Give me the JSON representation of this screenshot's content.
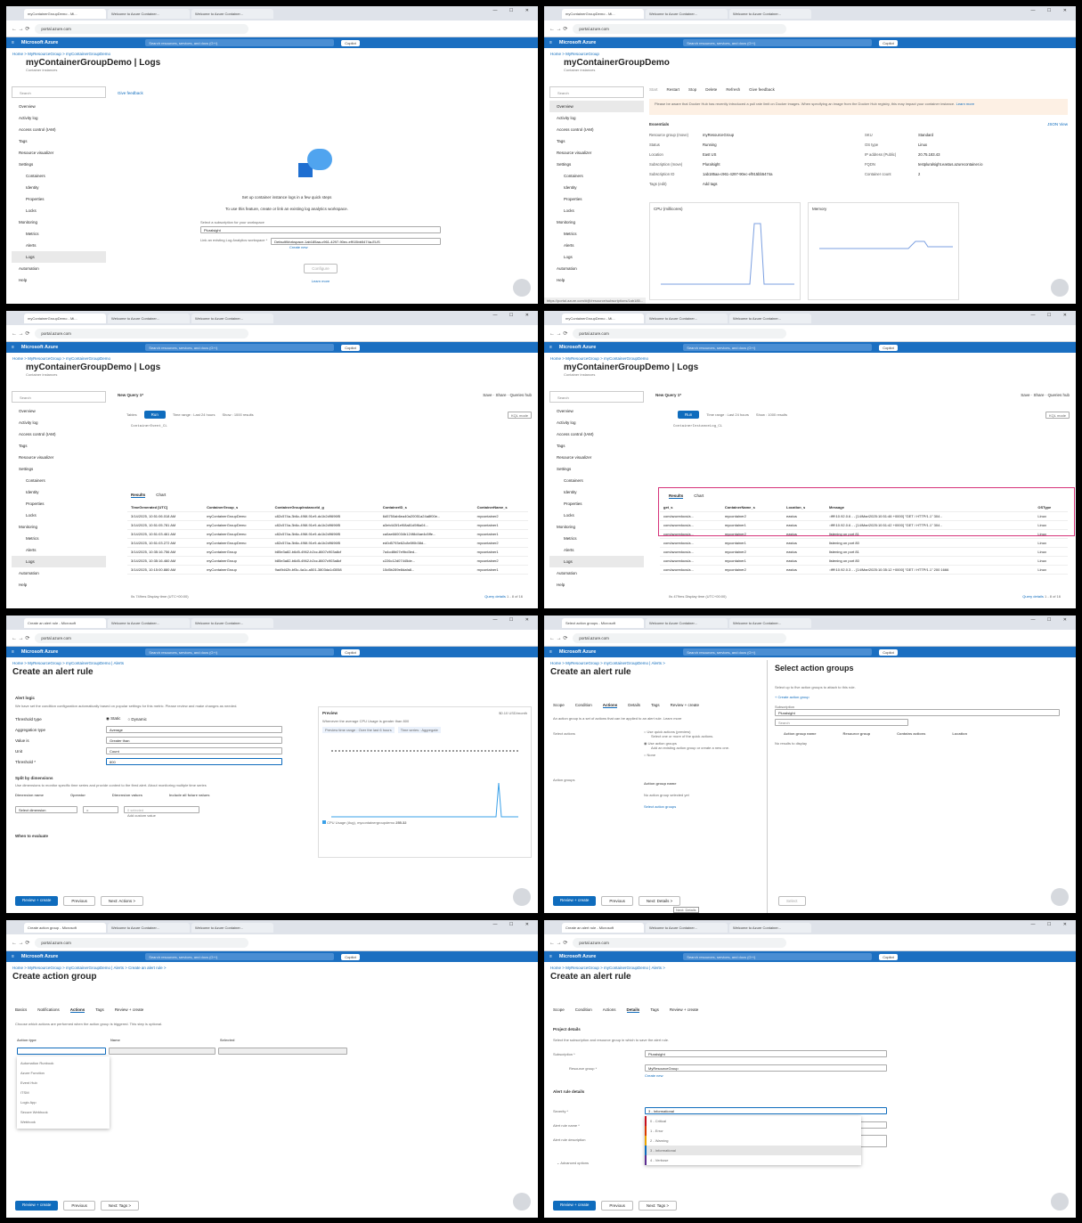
{
  "tabs": {
    "p1": [
      "myContainerGroupDemo - Mi...",
      "Welcome to Azure Container...",
      "Welcome to Azure Container..."
    ],
    "p5": [
      "Create an alert rule - Microsoft",
      "Welcome to Azure Container...",
      "Welcome to Azure Container..."
    ],
    "p6": [
      "Select action groups - Microsoft",
      "Welcome to Azure Container...",
      "Welcome to Azure Container..."
    ],
    "p7": [
      "Create action group - Microsoft",
      "Welcome to Azure Container...",
      "Welcome to Azure Container..."
    ],
    "p8": [
      "Create an alert rule - Microsoft",
      "Welcome to Azure Container...",
      "Welcome to Azure Container..."
    ]
  },
  "common": {
    "url": "portal.azure.com",
    "brand": "Microsoft Azure",
    "search": "Search resources, services, and docs (G+/)",
    "copilot": "Copilot",
    "window": "— ☐ ✕"
  },
  "side": {
    "search": "Search",
    "items": [
      "Overview",
      "Activity log",
      "Access control (IAM)",
      "Tags",
      "Resource visualizer",
      "Settings",
      "Containers",
      "Identity",
      "Properties",
      "Locks",
      "Monitoring",
      "Metrics",
      "Alerts",
      "Logs",
      "Automation",
      "Help"
    ]
  },
  "p1": {
    "bc": "Home > MyResourceGroup > myContainerGroupDemo",
    "title": "myContainerGroupDemo | Logs",
    "sub": "Container instances",
    "feedback": "Give feedback",
    "setup1": "Set up container instance logs in a few quick steps",
    "setup2": "To use this feature, create or link an existing log analytics workspace.",
    "sublabel": "Select a subscription for your workspace",
    "subval": "Pluralsight",
    "wslabel": "Link an existing Log Analytics workspace *",
    "wsval": "DefaultWorkspace-1ab185aa-c961-4297-90ec-ef915bb5474a-EUS",
    "create": "Create new",
    "configure": "Configure",
    "learn": "Learn more"
  },
  "p2": {
    "bc": "Home > MyResourceGroup",
    "title": "myContainerGroupDemo",
    "sub": "Container instances",
    "toolbar": [
      "Start",
      "Restart",
      "Stop",
      "Delete",
      "Refresh",
      "Give feedback"
    ],
    "warn": "Please be aware that Docker Hub has recently introduced a pull rate limit on Docker images. When specifying an image from the Docker Hub registry, this may impact your container instance.",
    "learn": "Learn more",
    "essentials": "Essentials",
    "json": "JSON View",
    "left": [
      [
        "Resource group (move)",
        "myResourceGroup"
      ],
      [
        "Status",
        "Running"
      ],
      [
        "Location",
        "East US"
      ],
      [
        "Subscription (move)",
        "Pluralsight"
      ],
      [
        "Subscription ID",
        "1ab185aa-c961-4297-90ec-ef915bb5474a"
      ],
      [
        "Tags (edit)",
        "Add tags"
      ]
    ],
    "right": [
      [
        "SKU",
        "Standard"
      ],
      [
        "OS type",
        "Linux"
      ],
      [
        "IP address (Public)",
        "20.75.183.43"
      ],
      [
        "FQDN",
        "testpluralsight.eastus.azurecontainer.io"
      ],
      [
        "Container count",
        "2"
      ]
    ],
    "cpu": "CPU (millicores)",
    "mem": "Memory",
    "status": "https://portal.azure.com/#@/resource/subscriptions/1ab185..."
  },
  "p3": {
    "bc": "Home > MyResourceGroup > myContainerGroupDemo",
    "title": "myContainerGroupDemo | Logs",
    "sub": "Container instances",
    "query": "New Query 1*",
    "save": "Save",
    "share": "Share",
    "qhub": "Queries hub",
    "tables": "Tables",
    "run": "Run",
    "range": "Time range : Last 24 hours",
    "show": "Show : 1000 results",
    "mode": "KQL mode",
    "code": "ContainerEvent_CL",
    "results": "Results",
    "chart": "Chart",
    "cols": [
      "TimeGenerated [UTC]",
      "ContainerGroup_s",
      "ContainerGroupInstanceId_g",
      "ContainerID_s",
      "ContainerName_s"
    ],
    "rows": [
      [
        "3/14/2025, 10:51:06.018 AM",
        "myContainerGroupDemo",
        "c82c574a-3b6c-496f-91e9-dc1b2d9696f5",
        "6d5750ab6ea40a20051a24a8f00e...",
        "mycontainer2"
      ],
      [
        "3/14/2025, 10:51:05.781 AM",
        "myContainerGroupDemo",
        "c82c574a-3b6c-496f-91e9-dc1b2d9696f5",
        "a3eb443f1ef08a81d5f6a04...",
        "mycontainer1"
      ],
      [
        "3/14/2025, 10:51:03.461 AM",
        "myContainerGroupDemo",
        "c82c574a-3b6c-496f-91e9-dc1b2d9696f5",
        "ca0ae660034b124f8d4ae4c5ffe...",
        "mycontainer1"
      ],
      [
        "3/14/2025, 10:51:03.272 AM",
        "myContainerGroupDemo",
        "c82c574a-3b6c-496f-91e9-dc1b2d9696f5",
        "ed0d5793e62c8e5f0b38d...",
        "mycontainer2"
      ],
      [
        "3/14/2025, 10:35:16.756 AM",
        "myContainerGroup",
        "b85e3a82-b6d5-4962-b2cc-8607c903a8cf",
        "7a4cd8b07e9bd3ed...",
        "mycontainer1"
      ],
      [
        "3/14/2025, 10:35:16.460 AM",
        "myContainerGroup",
        "b85e3a82-b6d5-4962-b2cc-8607c903a8cf",
        "c226c12d07445de...",
        "mycontainer2"
      ],
      [
        "3/14/2025, 10:15:00.880 AM",
        "myContainerGroup",
        "9ad9d42b-bf3c-4a1c-a501-3803da1d3058",
        "15d5b289e8dafa8...",
        "mycontainer1"
      ]
    ],
    "footer": "0s 749ms   Display time (UTC+00:00)",
    "qd": "Query details",
    "pg": "1 - 8 of 16"
  },
  "p4": {
    "code": "ContainerInstanceLog_CL",
    "cols": [
      "get_s",
      "ContainerName_s",
      "Location_s",
      "Message",
      "OSType"
    ],
    "rows": [
      [
        "com/azuredocs/a...",
        "mycontainer2",
        "eastus",
        "::ffff:10.92.0.6 - - [14/Mar/2025:10:51:46 +0000] \"GET / HTTP/1.1\" 304 -",
        "Linux"
      ],
      [
        "com/azuredocs/a...",
        "mycontainer1",
        "eastus",
        "::ffff:10.92.0.6 - - [14/Mar/2025:10:51:42 +0000] \"GET / HTTP/1.1\" 304 -",
        "Linux"
      ],
      [
        "com/azuredocs/a...",
        "mycontainer2",
        "eastus",
        "listening on port 81",
        "Linux"
      ],
      [
        "com/azuredocs/a...",
        "mycontainer1",
        "eastus",
        "listening on port 80",
        "Linux"
      ],
      [
        "com/azuredocs/a...",
        "mycontainer2",
        "eastus",
        "listening on port 81",
        "Linux"
      ],
      [
        "com/azuredocs/a...",
        "mycontainer1",
        "eastus",
        "listening on port 80",
        "Linux"
      ],
      [
        "com/azuredocs/a...",
        "mycontainer2",
        "eastus",
        "::ffff:10.92.0.3 - - [14/Mar/2025:10:35:12 +0000] \"GET / HTTP/1.1\" 200 1666",
        "Linux"
      ]
    ],
    "footer": "0s 479ms   Display time (UTC+00:00)",
    "pg": "1 - 8 of 16"
  },
  "p5": {
    "bc": "Home > MyResourceGroup > myContainerGroupDemo | Alerts",
    "title": "Create an alert rule",
    "logic": "Alert logic",
    "info": "We have set the condition configuration automatically based on popular settings for this metric. Please review and make changes as needed.",
    "fields": [
      [
        "Threshold type",
        "Static"
      ],
      [
        "Aggregation type",
        "Average"
      ],
      [
        "Value is",
        "Greater than"
      ],
      [
        "Unit",
        "Count"
      ],
      [
        "Threshold *",
        "800"
      ]
    ],
    "dynamic": "Dynamic",
    "split": "Split by dimensions",
    "splitdesc": "Use dimensions to monitor specific time series and provide context to the fired alert. About monitoring multiple time series",
    "dimcols": [
      "Dimension name",
      "Operator",
      "Dimension values",
      "Include all future values"
    ],
    "dimsel": "Select dimension",
    "op": "=",
    "vals": "0 selected",
    "custom": "Add custom value",
    "when": "When to evaluate",
    "preview": "Preview",
    "price": "$0.10 USD/month",
    "pdesc": "Whenever the average CPU Usage is greater than 800",
    "ptr": "Preview time range : Over the last 6 hours",
    "pts": "Time series : Aggregate",
    "legend": "CPU Usage (Avg), mycontainergroupdemo",
    "lval": "255.32",
    "buttons": [
      "Review + create",
      "Previous",
      "Next: Actions >"
    ]
  },
  "p6": {
    "bc": "Home > MyResourceGroup > myContainerGroupDemo | Alerts >",
    "title": "Create an alert rule",
    "tabs": [
      "Scope",
      "Condition",
      "Actions",
      "Details",
      "Tags",
      "Review + create"
    ],
    "desc": "An action group is a set of actions that can be applied to an alert rule. Learn more",
    "selactions": "Select actions",
    "opt1": "Use quick actions (preview)",
    "opt1d": "Select one or more of the quick actions.",
    "opt2": "Use action groups",
    "opt2d": "Add an existing action group or create a new one.",
    "opt3": "None",
    "ag": "Action groups",
    "agname": "Action group name",
    "none": "No action group selected yet",
    "sel": "Select action groups",
    "flyout": {
      "title": "Select action groups",
      "desc": "Select up to five action groups to attach to this rule.",
      "create": "Create action group",
      "subl": "Subscription",
      "subv": "Pluralsight",
      "search": "Search",
      "cols": [
        "Action group name",
        "Resource group",
        "Contains actions",
        "Location"
      ],
      "empty": "No results to display",
      "select": "Select"
    },
    "buttons": [
      "Review + create",
      "Previous",
      "Next: Details >"
    ],
    "tip": "Next: Details"
  },
  "p7": {
    "bc": "Home > MyResourceGroup > myContainerGroupDemo | Alerts > Create an alert rule >",
    "title": "Create action group",
    "tabs": [
      "Basics",
      "Notifications",
      "Actions",
      "Tags",
      "Review + create"
    ],
    "desc": "Choose which actions are performed when the action group is triggered. This step is optional.",
    "cols": [
      "Action type",
      "Name",
      "Selected"
    ],
    "options": [
      "Automation Runbook",
      "Azure Function",
      "Event Hub",
      "ITSM",
      "Logic App",
      "Secure Webhook",
      "Webhook"
    ],
    "buttons": [
      "Review + create",
      "Previous",
      "Next: Tags >"
    ]
  },
  "p8": {
    "bc": "Home > MyResourceGroup > myContainerGroupDemo | Alerts >",
    "title": "Create an alert rule",
    "tabs": [
      "Scope",
      "Condition",
      "Actions",
      "Details",
      "Tags",
      "Review + create"
    ],
    "proj": "Project details",
    "projdesc": "Select the subscription and resource group in which to save the alert rule.",
    "subl": "Subscription *",
    "subv": "Pluralsight",
    "rgl": "Resource group *",
    "rgv": "MyResourceGroup",
    "create": "Create new",
    "ard": "Alert rule details",
    "sevl": "Severity *",
    "sevv": "3 - Informational",
    "namel": "Alert rule name *",
    "descl": "Alert rule description",
    "adv": "Advanced options",
    "sev": [
      "0 - Critical",
      "1 - Error",
      "2 - Warning",
      "3 - Informational",
      "4 - Verbose"
    ],
    "buttons": [
      "Review + create",
      "Previous",
      "Next: Tags >"
    ]
  }
}
